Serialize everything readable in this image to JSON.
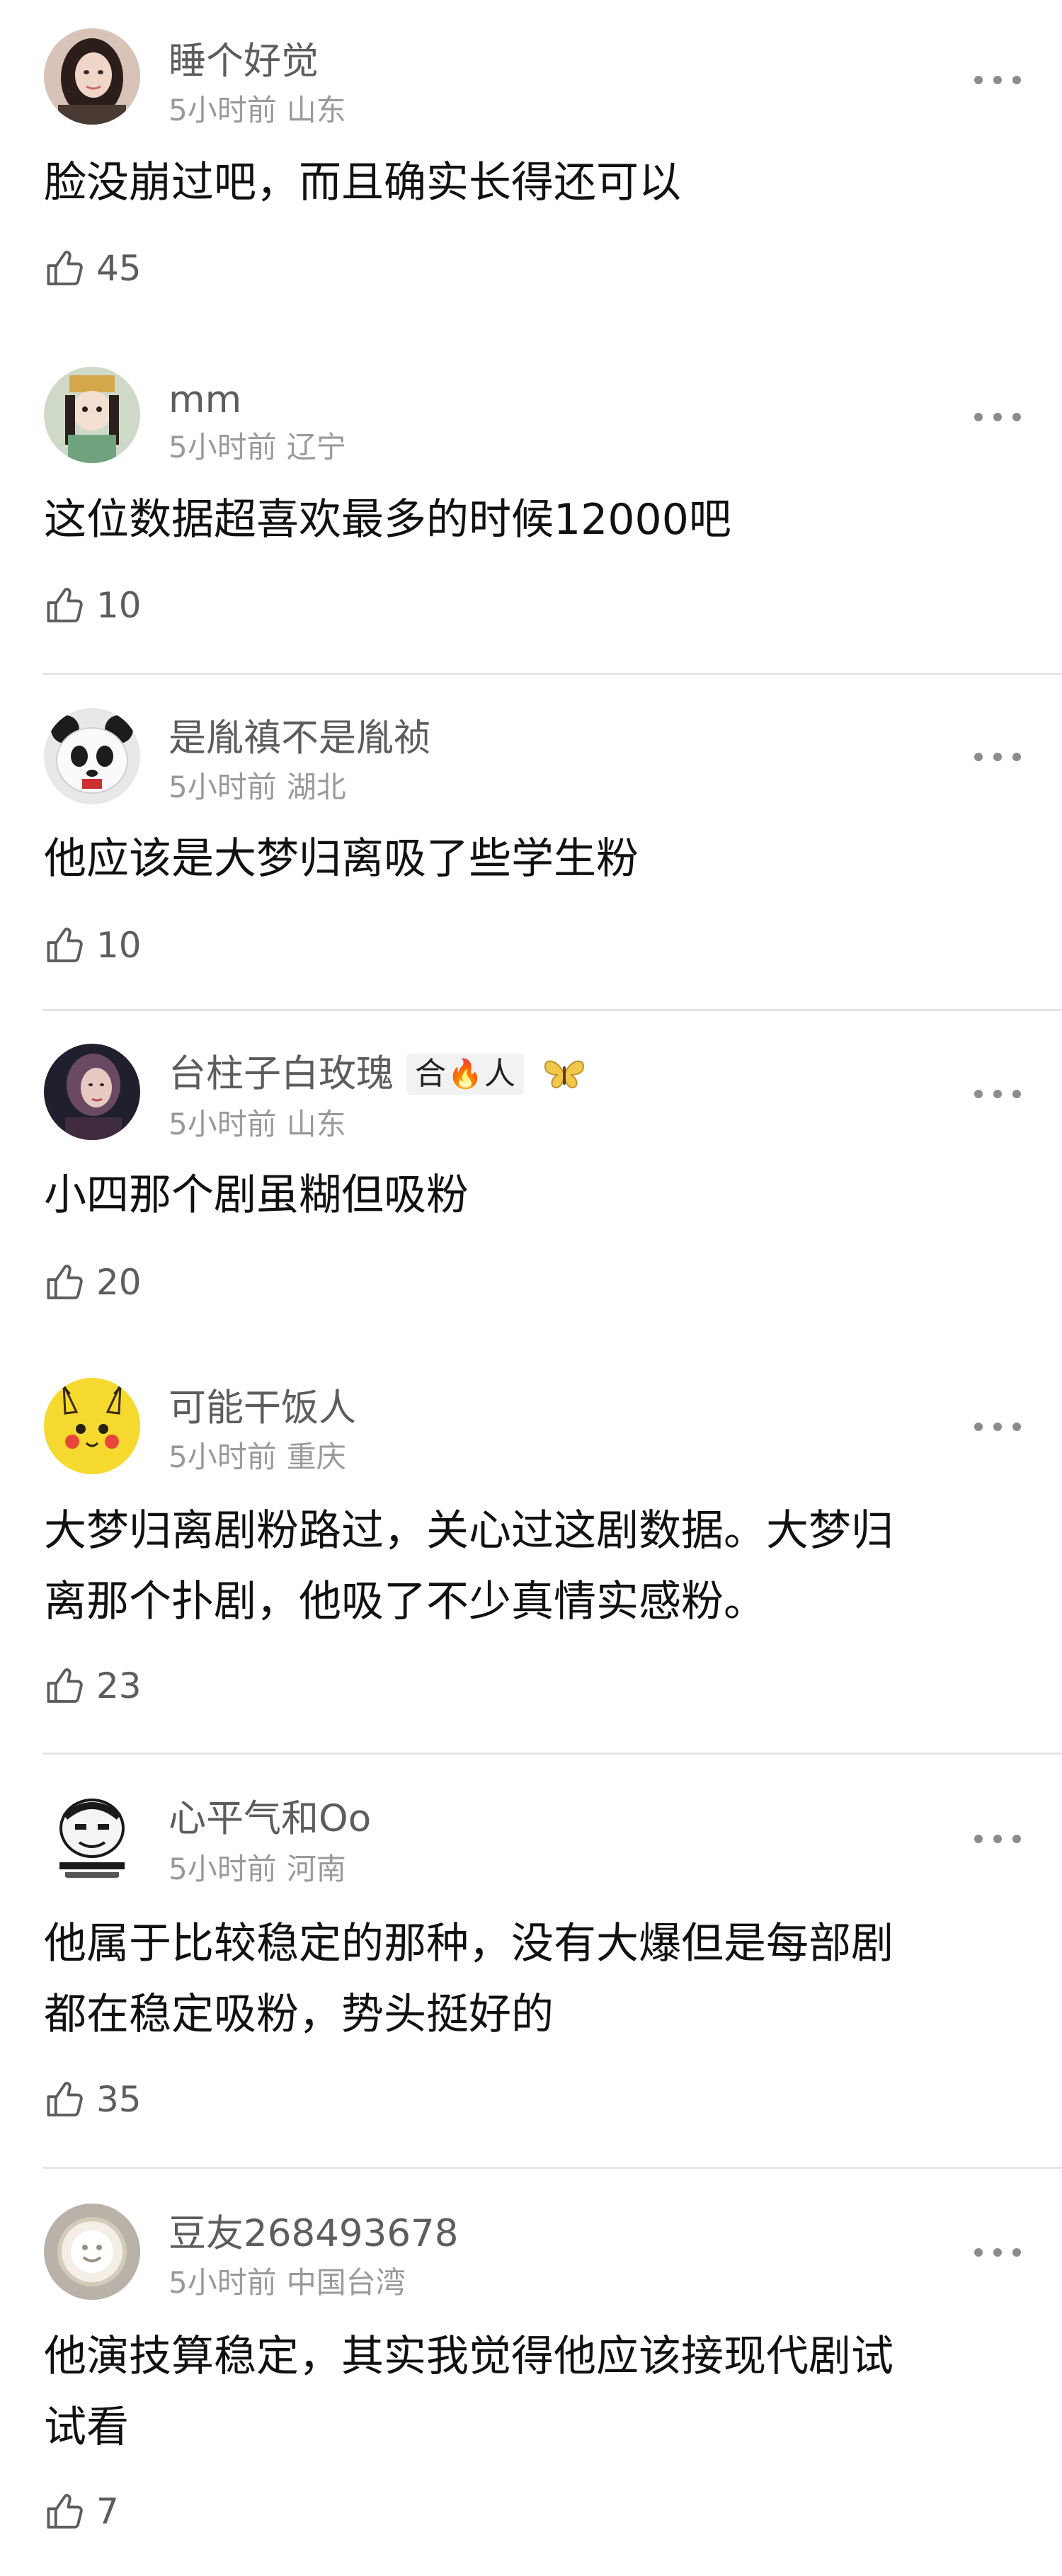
{
  "comments": [
    {
      "username": "睡个好觉",
      "time": "5小时前",
      "location": "山东",
      "text_lines": [
        "脸没崩过吧，而且确实长得还可以"
      ],
      "likes": "45"
    },
    {
      "username": "mm",
      "time": "5小时前",
      "location": "辽宁",
      "text_lines": [
        "这位数据超喜欢最多的时候12000吧"
      ],
      "likes": "10"
    },
    {
      "username": "是胤禛不是胤祯",
      "time": "5小时前",
      "location": "湖北",
      "text_lines": [
        "他应该是大梦归离吸了些学生粉"
      ],
      "likes": "10"
    },
    {
      "username": "台柱子白玫瑰",
      "badge": {
        "prefix": "合",
        "emoji": "🔥",
        "suffix": "人"
      },
      "time": "5小时前",
      "location": "山东",
      "text_lines": [
        "小四那个剧虽糊但吸粉"
      ],
      "likes": "20"
    },
    {
      "username": "可能干饭人",
      "time": "5小时前",
      "location": "重庆",
      "text_lines": [
        "大梦归离剧粉路过，关心过这剧数据。大梦归",
        "离那个扑剧，他吸了不少真情实感粉。"
      ],
      "likes": "23"
    },
    {
      "username": "心平气和Oo",
      "time": "5小时前",
      "location": "河南",
      "text_lines": [
        "他属于比较稳定的那种，没有大爆但是每部剧",
        "都在稳定吸粉，势头挺好的"
      ],
      "likes": "35"
    },
    {
      "username": "豆友268493678",
      "time": "5小时前",
      "location": "中国台湾",
      "text_lines": [
        "他演技算稳定，其实我觉得他应该接现代剧试",
        "试看"
      ],
      "likes": "7"
    }
  ],
  "icons": {
    "more": "more-dots-icon",
    "like": "thumbs-up-icon"
  },
  "colors": {
    "username": "#5d5d5d",
    "meta": "#9a9a9a",
    "text": "#111111",
    "divider": "#e6e6e6"
  }
}
